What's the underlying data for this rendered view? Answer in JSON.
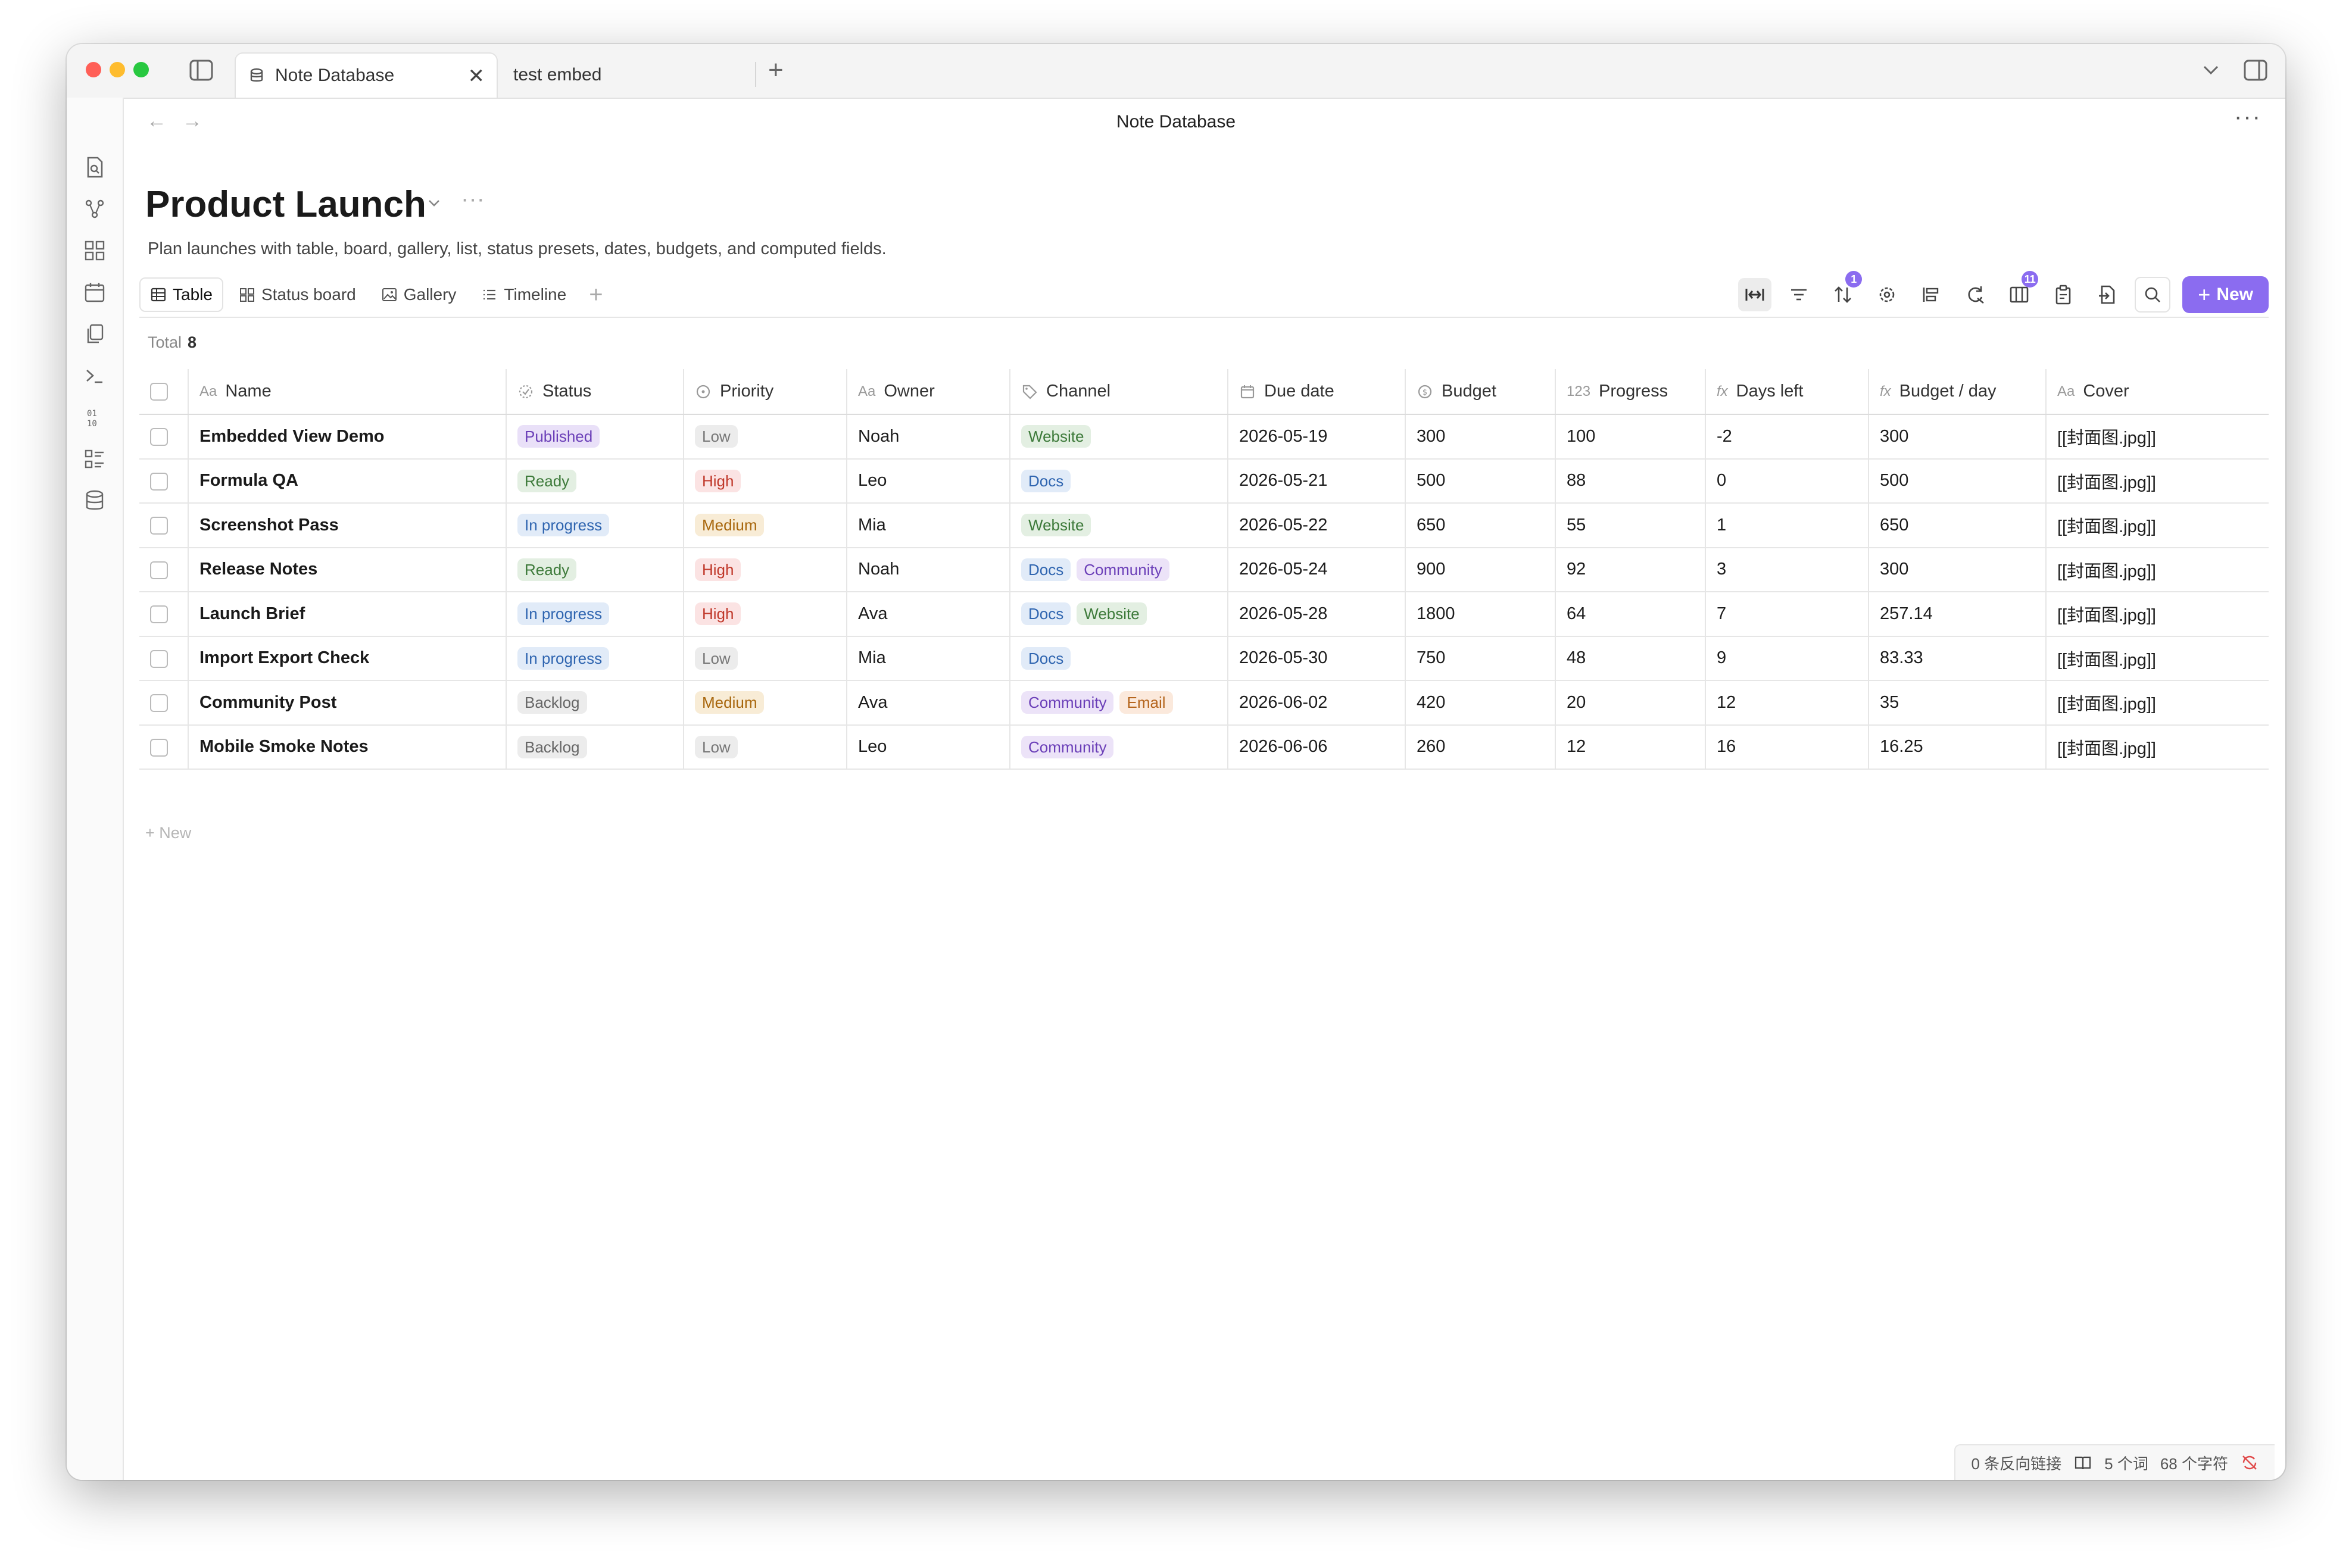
{
  "window": {
    "tabs": [
      {
        "label": "Note Database",
        "active": true
      },
      {
        "label": "test embed",
        "active": false
      }
    ],
    "doc_title": "Note Database"
  },
  "page": {
    "title": "Product Launch",
    "description": "Plan launches with table, board, gallery, list, status presets, dates, budgets, and computed fields."
  },
  "views": [
    {
      "label": "Table",
      "icon": "table-icon",
      "active": true
    },
    {
      "label": "Status board",
      "icon": "board-icon",
      "active": false
    },
    {
      "label": "Gallery",
      "icon": "gallery-icon",
      "active": false
    },
    {
      "label": "Timeline",
      "icon": "timeline-icon",
      "active": false
    }
  ],
  "toolbar": {
    "sort_badge": "1",
    "columns_badge": "11",
    "new_label": "New"
  },
  "total": {
    "label": "Total",
    "count": "8"
  },
  "columns": [
    {
      "label": "Name",
      "icon": "Aa"
    },
    {
      "label": "Status",
      "icon": "status-icon"
    },
    {
      "label": "Priority",
      "icon": "priority-icon"
    },
    {
      "label": "Owner",
      "icon": "Aa"
    },
    {
      "label": "Channel",
      "icon": "tag-icon"
    },
    {
      "label": "Due date",
      "icon": "calendar-icon"
    },
    {
      "label": "Budget",
      "icon": "dollar-icon"
    },
    {
      "label": "Progress",
      "icon": "123"
    },
    {
      "label": "Days left",
      "icon": "fx"
    },
    {
      "label": "Budget / day",
      "icon": "fx"
    },
    {
      "label": "Cover",
      "icon": "Aa"
    }
  ],
  "rows": [
    {
      "name": "Embedded View Demo",
      "status": "Published",
      "priority": "Low",
      "owner": "Noah",
      "channels": [
        "Website"
      ],
      "due": "2026-05-19",
      "budget": "300",
      "progress": "100",
      "days_left": "-2",
      "budget_day": "300",
      "cover": "[[封面图.jpg]]"
    },
    {
      "name": "Formula QA",
      "status": "Ready",
      "priority": "High",
      "owner": "Leo",
      "channels": [
        "Docs"
      ],
      "due": "2026-05-21",
      "budget": "500",
      "progress": "88",
      "days_left": "0",
      "budget_day": "500",
      "cover": "[[封面图.jpg]]"
    },
    {
      "name": "Screenshot Pass",
      "status": "In progress",
      "priority": "Medium",
      "owner": "Mia",
      "channels": [
        "Website"
      ],
      "due": "2026-05-22",
      "budget": "650",
      "progress": "55",
      "days_left": "1",
      "budget_day": "650",
      "cover": "[[封面图.jpg]]"
    },
    {
      "name": "Release Notes",
      "status": "Ready",
      "priority": "High",
      "owner": "Noah",
      "channels": [
        "Docs",
        "Community"
      ],
      "due": "2026-05-24",
      "budget": "900",
      "progress": "92",
      "days_left": "3",
      "budget_day": "300",
      "cover": "[[封面图.jpg]]"
    },
    {
      "name": "Launch Brief",
      "status": "In progress",
      "priority": "High",
      "owner": "Ava",
      "channels": [
        "Docs",
        "Website"
      ],
      "due": "2026-05-28",
      "budget": "1800",
      "progress": "64",
      "days_left": "7",
      "budget_day": "257.14",
      "cover": "[[封面图.jpg]]"
    },
    {
      "name": "Import Export Check",
      "status": "In progress",
      "priority": "Low",
      "owner": "Mia",
      "channels": [
        "Docs"
      ],
      "due": "2026-05-30",
      "budget": "750",
      "progress": "48",
      "days_left": "9",
      "budget_day": "83.33",
      "cover": "[[封面图.jpg]]"
    },
    {
      "name": "Community Post",
      "status": "Backlog",
      "priority": "Medium",
      "owner": "Ava",
      "channels": [
        "Community",
        "Email"
      ],
      "due": "2026-06-02",
      "budget": "420",
      "progress": "20",
      "days_left": "12",
      "budget_day": "35",
      "cover": "[[封面图.jpg]]"
    },
    {
      "name": "Mobile Smoke Notes",
      "status": "Backlog",
      "priority": "Low",
      "owner": "Leo",
      "channels": [
        "Community"
      ],
      "due": "2026-06-06",
      "budget": "260",
      "progress": "12",
      "days_left": "16",
      "budget_day": "16.25",
      "cover": "[[封面图.jpg]]"
    }
  ],
  "pill_colors": {
    "Published": {
      "bg": "#e9e0f8",
      "fg": "#6b3fb8"
    },
    "Ready": {
      "bg": "#e3efe2",
      "fg": "#3d7a3a"
    },
    "In progress": {
      "bg": "#e1ebf8",
      "fg": "#2f65b0"
    },
    "Backlog": {
      "bg": "#ececec",
      "fg": "#666666"
    },
    "Low": {
      "bg": "#ececec",
      "fg": "#777777"
    },
    "High": {
      "bg": "#fbe3e3",
      "fg": "#c0392b"
    },
    "Medium": {
      "bg": "#f8ecd6",
      "fg": "#a8670e"
    },
    "Website": {
      "bg": "#e3efe2",
      "fg": "#3d7a3a"
    },
    "Docs": {
      "bg": "#e1ebf8",
      "fg": "#2f65b0"
    },
    "Community": {
      "bg": "#ece3f8",
      "fg": "#6b3fb8"
    },
    "Email": {
      "bg": "#fbe9dc",
      "fg": "#b5651d"
    }
  },
  "new_row_label": "+ New",
  "statusbar": {
    "backlinks": "0 条反向链接",
    "words": "5 个词",
    "chars": "68 个字符"
  },
  "accent": "#8b6cf0"
}
